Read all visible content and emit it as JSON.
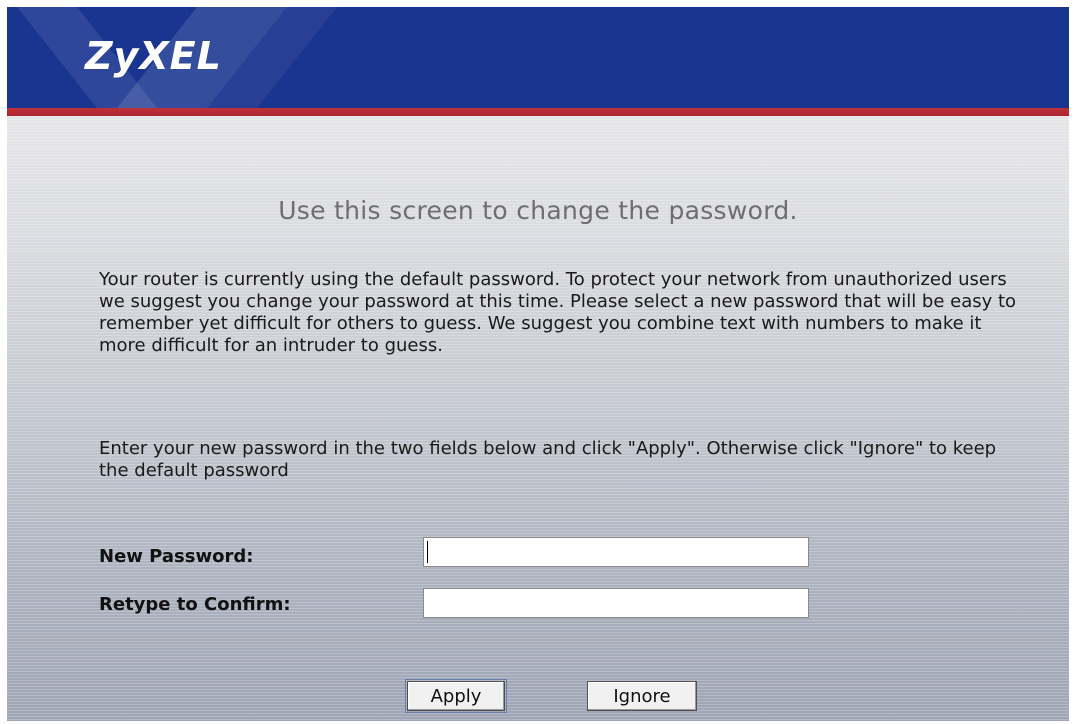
{
  "header": {
    "brand": "ZyXEL",
    "colors": {
      "header_bg": "#1a3590",
      "accent_stripe": "#c0303a",
      "logo_text": "#ffffff"
    }
  },
  "main": {
    "title": "Use this screen to change the password.",
    "paragraph_1": "Your router is currently using the default password. To protect your network from unauthorized users we suggest you change your password at this time. Please select a new password that will be easy to remember yet difficult for others to guess.  We suggest you combine text with numbers to make it more difficult for an intruder to guess.",
    "paragraph_2": "Enter your new password in the two fields below and click \"Apply\". Otherwise click \"Ignore\" to keep the default password"
  },
  "form": {
    "new_password": {
      "label": "New Password:",
      "value": ""
    },
    "confirm_password": {
      "label": "Retype to Confirm:",
      "value": ""
    }
  },
  "buttons": {
    "apply": "Apply",
    "ignore": "Ignore"
  }
}
